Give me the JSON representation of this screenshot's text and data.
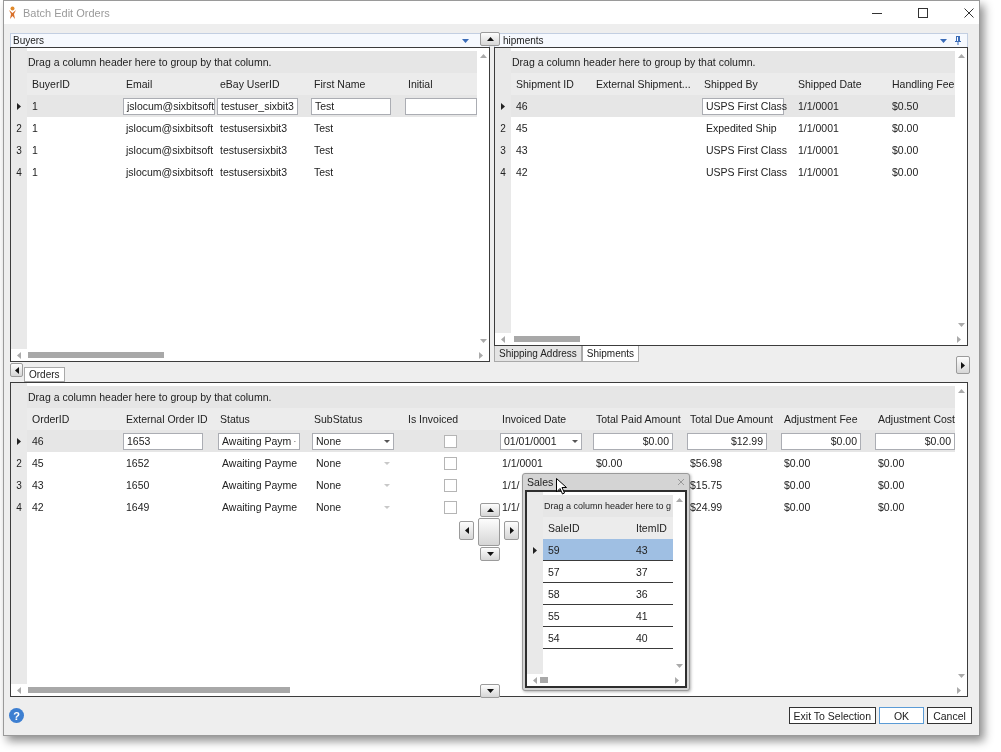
{
  "window": {
    "title": "Batch Edit Orders"
  },
  "buyers": {
    "title": "Buyers",
    "group_hint": "Drag a column header here to group by that column.",
    "columns": [
      "BuyerID",
      "Email",
      "eBay UserID",
      "First Name",
      "Initial"
    ],
    "rows": [
      {
        "current": true,
        "cells": [
          {
            "kind": "text",
            "text": "1"
          },
          {
            "kind": "field",
            "text": "jslocum@sixbitsoft"
          },
          {
            "kind": "field",
            "text": "testuser_sixbit3"
          },
          {
            "kind": "field",
            "text": "Test"
          },
          {
            "kind": "field"
          }
        ]
      },
      {
        "current": false,
        "number": "2",
        "cells": [
          {
            "kind": "text",
            "text": "1"
          },
          {
            "kind": "text",
            "text": "jslocum@sixbitsoft"
          },
          {
            "kind": "text",
            "text": "testusersixbit3"
          },
          {
            "kind": "text",
            "text": "Test"
          }
        ]
      },
      {
        "current": false,
        "number": "3",
        "cells": [
          {
            "kind": "text",
            "text": "1"
          },
          {
            "kind": "text",
            "text": "jslocum@sixbitsoft"
          },
          {
            "kind": "text",
            "text": "testusersixbit3"
          },
          {
            "kind": "text",
            "text": "Test"
          }
        ]
      },
      {
        "current": false,
        "number": "4",
        "cells": [
          {
            "kind": "text",
            "text": "1"
          },
          {
            "kind": "text",
            "text": "jslocum@sixbitsoft"
          },
          {
            "kind": "text",
            "text": "testusersixbit3"
          },
          {
            "kind": "text",
            "text": "Test"
          }
        ]
      }
    ]
  },
  "shipments": {
    "title": "hipments",
    "group_hint": "Drag a column header here to group by that column.",
    "columns": [
      "Shipment ID",
      "External Shipment...",
      "Shipped By",
      "Shipped Date",
      "Handling Fee"
    ],
    "rows": [
      {
        "current": true,
        "cells": [
          {
            "kind": "text",
            "text": "46"
          },
          {
            "kind": "blank"
          },
          {
            "kind": "combo",
            "text": "USPS First Class"
          },
          {
            "kind": "text",
            "text": "1/1/0001"
          },
          {
            "kind": "text",
            "text": "$0.50"
          }
        ]
      },
      {
        "current": false,
        "number": "2",
        "cells": [
          {
            "kind": "text",
            "text": "45"
          },
          {
            "kind": "blank"
          },
          {
            "kind": "combo",
            "text": "Expedited Ship"
          },
          {
            "kind": "text",
            "text": "1/1/0001"
          },
          {
            "kind": "text",
            "text": "$0.00"
          }
        ]
      },
      {
        "current": false,
        "number": "3",
        "cells": [
          {
            "kind": "text",
            "text": "43"
          },
          {
            "kind": "blank"
          },
          {
            "kind": "combo",
            "text": "USPS First Class"
          },
          {
            "kind": "text",
            "text": "1/1/0001"
          },
          {
            "kind": "text",
            "text": "$0.00"
          }
        ]
      },
      {
        "current": false,
        "number": "4",
        "cells": [
          {
            "kind": "text",
            "text": "42"
          },
          {
            "kind": "blank"
          },
          {
            "kind": "combo",
            "text": "USPS First Class"
          },
          {
            "kind": "text",
            "text": "1/1/0001"
          },
          {
            "kind": "text",
            "text": "$0.00"
          }
        ]
      }
    ],
    "tabs": [
      {
        "label": "Shipping Address",
        "selected": false
      },
      {
        "label": "Shipments",
        "selected": true
      }
    ]
  },
  "orders": {
    "tabs": [
      {
        "label": "Orders",
        "selected": true
      }
    ],
    "group_hint": "Drag a column header here to group by that column.",
    "columns": [
      "OrderID",
      "External Order ID",
      "Status",
      "SubStatus",
      "Is Invoiced",
      "Invoiced Date",
      "Total Paid Amount",
      "Total Due Amount",
      "Adjustment Fee",
      "Adjustment Cost"
    ],
    "rows": [
      {
        "current": true,
        "cells": [
          {
            "kind": "text",
            "text": "46"
          },
          {
            "kind": "field",
            "text": "1653"
          },
          {
            "kind": "combo",
            "text": "Awaiting Paym"
          },
          {
            "kind": "combo",
            "text": "None"
          },
          {
            "kind": "check",
            "checked": false
          },
          {
            "kind": "combo",
            "text": "01/01/0001"
          },
          {
            "kind": "money",
            "text": "$0.00"
          },
          {
            "kind": "money",
            "text": "$12.99"
          },
          {
            "kind": "money",
            "text": "$0.00"
          },
          {
            "kind": "money",
            "text": "$0.00"
          }
        ]
      },
      {
        "current": false,
        "number": "2",
        "cells": [
          {
            "kind": "text",
            "text": "45"
          },
          {
            "kind": "text",
            "text": "1652"
          },
          {
            "kind": "combo",
            "text": "Awaiting Payme"
          },
          {
            "kind": "combo",
            "text": "None"
          },
          {
            "kind": "check",
            "checked": false
          },
          {
            "kind": "text",
            "text": "1/1/0001"
          },
          {
            "kind": "text",
            "text": "$0.00"
          },
          {
            "kind": "text",
            "text": "$56.98"
          },
          {
            "kind": "text",
            "text": "$0.00"
          },
          {
            "kind": "text",
            "text": "$0.00"
          }
        ]
      },
      {
        "current": false,
        "number": "3",
        "cells": [
          {
            "kind": "text",
            "text": "43"
          },
          {
            "kind": "text",
            "text": "1650"
          },
          {
            "kind": "combo",
            "text": "Awaiting Payme"
          },
          {
            "kind": "combo",
            "text": "None"
          },
          {
            "kind": "check",
            "checked": false
          },
          {
            "kind": "text",
            "text": "1/1/"
          },
          {
            "kind": "blank"
          },
          {
            "kind": "text",
            "text": "$15.75"
          },
          {
            "kind": "text",
            "text": "$0.00"
          },
          {
            "kind": "text",
            "text": "$0.00"
          }
        ]
      },
      {
        "current": false,
        "number": "4",
        "cells": [
          {
            "kind": "text",
            "text": "42"
          },
          {
            "kind": "text",
            "text": "1649"
          },
          {
            "kind": "combo",
            "text": "Awaiting Payme"
          },
          {
            "kind": "combo",
            "text": "None"
          },
          {
            "kind": "check",
            "checked": false
          },
          {
            "kind": "text",
            "text": "1/1/"
          },
          {
            "kind": "blank"
          },
          {
            "kind": "text",
            "text": "$24.99"
          },
          {
            "kind": "text",
            "text": "$0.00"
          },
          {
            "kind": "text",
            "text": "$0.00"
          }
        ]
      }
    ]
  },
  "sales_window": {
    "title": "Sales",
    "group_hint": "Drag a column header here to g",
    "columns": [
      "SaleID",
      "ItemID"
    ],
    "rows": [
      {
        "current": true,
        "selected": true,
        "cells": [
          "59",
          "43"
        ]
      },
      {
        "current": false,
        "selected": false,
        "cells": [
          "57",
          "37"
        ]
      },
      {
        "current": false,
        "selected": false,
        "cells": [
          "58",
          "36"
        ]
      },
      {
        "current": false,
        "selected": false,
        "cells": [
          "55",
          "41"
        ]
      },
      {
        "current": false,
        "selected": false,
        "cells": [
          "54",
          "40"
        ]
      }
    ]
  },
  "footer": {
    "help": "?",
    "buttons": [
      {
        "label": "Exit To Selection",
        "default": false
      },
      {
        "label": "OK",
        "default": true
      },
      {
        "label": "Cancel",
        "default": false
      }
    ]
  }
}
